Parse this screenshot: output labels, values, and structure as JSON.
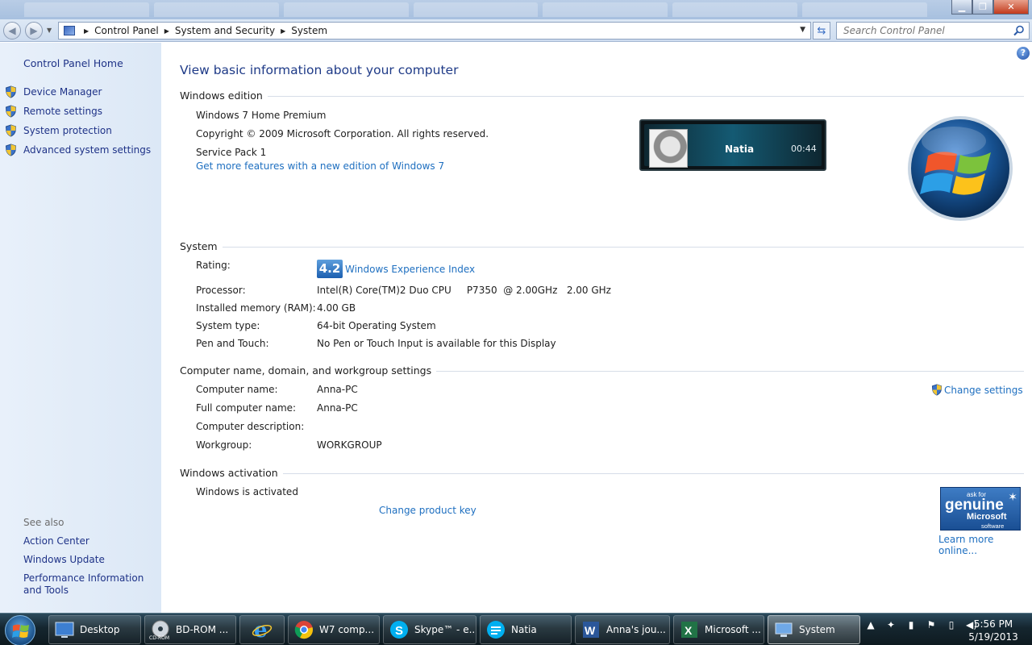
{
  "window": {
    "minimize": "▁",
    "maximize": "❐",
    "close": "✕"
  },
  "address": {
    "crumbs": [
      "Control Panel",
      "System and Security",
      "System"
    ],
    "search_placeholder": "Search Control Panel"
  },
  "sidebar": {
    "home": "Control Panel Home",
    "tasks": [
      "Device Manager",
      "Remote settings",
      "System protection",
      "Advanced system settings"
    ],
    "see_also_title": "See also",
    "see_also": [
      "Action Center",
      "Windows Update",
      "Performance Information and Tools"
    ]
  },
  "main": {
    "heading": "View basic information about your computer",
    "edition": {
      "title": "Windows edition",
      "name": "Windows 7 Home Premium",
      "copyright": "Copyright © 2009 Microsoft Corporation.  All rights reserved.",
      "service_pack": "Service Pack 1",
      "upgrade_link": "Get more features with a new edition of Windows 7"
    },
    "media_widget": {
      "name": "Natia",
      "time": "00:44"
    },
    "system": {
      "title": "System",
      "rating_label": "Rating:",
      "rating_score": "4.2",
      "rating_link": "Windows Experience Index",
      "processor_label": "Processor:",
      "processor_value": "Intel(R) Core(TM)2 Duo CPU     P7350  @ 2.00GHz   2.00 GHz",
      "memory_label": "Installed memory (RAM):",
      "memory_value": "4.00 GB",
      "type_label": "System type:",
      "type_value": "64-bit Operating System",
      "pen_label": "Pen and Touch:",
      "pen_value": "No Pen or Touch Input is available for this Display"
    },
    "computer": {
      "title": "Computer name, domain, and workgroup settings",
      "name_label": "Computer name:",
      "name_value": "Anna-PC",
      "full_label": "Full computer name:",
      "full_value": "Anna-PC",
      "desc_label": "Computer description:",
      "desc_value": "",
      "wg_label": "Workgroup:",
      "wg_value": "WORKGROUP",
      "change_link": "Change settings"
    },
    "activation": {
      "title": "Windows activation",
      "status": "Windows is activated",
      "product_key_link": "Change product key",
      "genuine_line1": "ask for",
      "genuine_line2": "genuine",
      "genuine_line3": "Microsoft",
      "genuine_line4": "software",
      "learn_more": "Learn more online..."
    }
  },
  "taskbar": {
    "items": [
      "Desktop",
      "BD-ROM ...",
      "",
      "W7 comp...",
      "Skype™ - e...",
      "Natia",
      "Anna's jou...",
      "Microsoft ...",
      "System"
    ],
    "cdrom_badge": "CD-ROM",
    "clock_time": "5:56 PM",
    "clock_date": "5/19/2013"
  },
  "colors": {
    "link": "#1e6fc0",
    "nav_link": "#1e3287",
    "heading": "#1e3a87"
  }
}
